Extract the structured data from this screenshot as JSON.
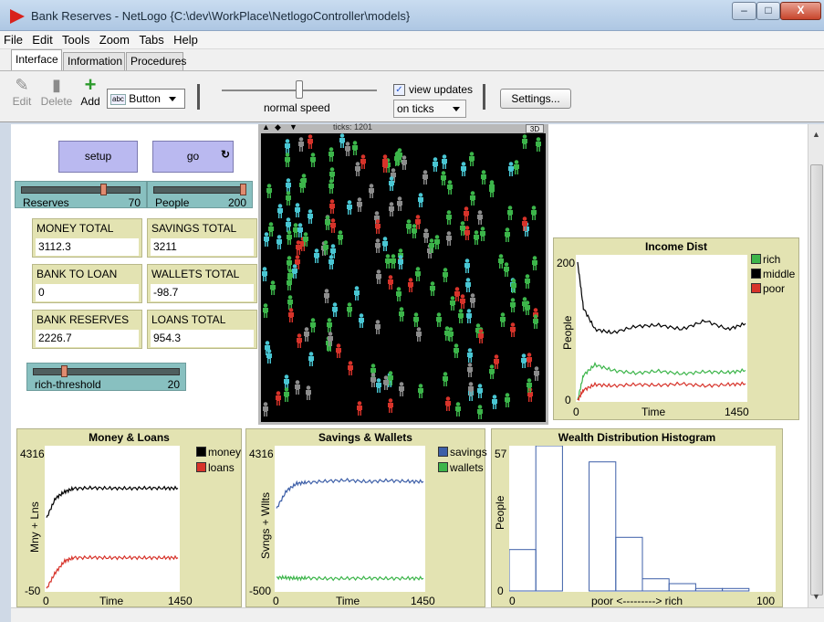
{
  "window": {
    "title": "Bank Reserves - NetLogo {C:\\dev\\WorkPlace\\NetlogoController\\models}",
    "minimize": "–",
    "maximize": "□",
    "close": "X"
  },
  "menu": [
    "File",
    "Edit",
    "Tools",
    "Zoom",
    "Tabs",
    "Help"
  ],
  "tabs": [
    "Interface",
    "Information",
    "Procedures"
  ],
  "toolbar": {
    "edit": "Edit",
    "delete": "Delete",
    "add": "Add",
    "widget_type": "Button",
    "widget_icon_text": "abc",
    "speed_label": "normal speed",
    "view_updates": "view updates",
    "view_updates_checked": true,
    "update_mode": "on ticks",
    "settings": "Settings..."
  },
  "buttons": {
    "setup": "setup",
    "go": "go",
    "forever_icon": "↻"
  },
  "sliders": {
    "reserves": {
      "label": "Reserves",
      "value": "70",
      "fraction": 0.7
    },
    "people": {
      "label": "People",
      "value": "200",
      "fraction": 1.0
    },
    "rich_threshold": {
      "label": "rich-threshold",
      "value": "20",
      "fraction": 0.2
    }
  },
  "monitors": {
    "money_total": {
      "label": "MONEY TOTAL",
      "value": "3112.3"
    },
    "savings_total": {
      "label": "SAVINGS TOTAL",
      "value": "3211"
    },
    "bank_to_loan": {
      "label": "BANK TO LOAN",
      "value": "0"
    },
    "wallets_total": {
      "label": "WALLETS TOTAL",
      "value": "-98.7"
    },
    "bank_reserves": {
      "label": "BANK RESERVES",
      "value": "2226.7"
    },
    "loans_total": {
      "label": "LOANS TOTAL",
      "value": "954.3"
    }
  },
  "view": {
    "ticks_label": "ticks: 1201",
    "btn_3d": "3D"
  },
  "colors": {
    "rich": "#3cb54a",
    "middle": "#000000",
    "poor": "#d7332a",
    "money": "#000000",
    "loans": "#d7332a",
    "savings": "#3d5fa8",
    "wallets": "#3cb54a",
    "histogram": "#3d5fa8",
    "turtle_cyan": "#49c6d3",
    "turtle_gray": "#8c8c8c"
  },
  "chart_data": [
    {
      "type": "line",
      "title": "Income Dist",
      "xlabel": "Time",
      "ylabel": "People",
      "xlim": [
        0,
        1450
      ],
      "ylim": [
        0,
        200
      ],
      "x_tick_labels": [
        "0",
        "1450"
      ],
      "y_tick_labels": [
        "200",
        "0"
      ],
      "series": [
        {
          "name": "rich",
          "x": [
            0,
            50,
            150,
            300,
            500,
            700,
            900,
            1100,
            1300,
            1450
          ],
          "values": [
            0,
            35,
            50,
            42,
            38,
            41,
            37,
            40,
            39,
            42
          ]
        },
        {
          "name": "middle",
          "x": [
            0,
            50,
            150,
            300,
            500,
            700,
            900,
            1100,
            1300,
            1450
          ],
          "values": [
            195,
            130,
            100,
            95,
            104,
            106,
            100,
            112,
            100,
            108
          ]
        },
        {
          "name": "poor",
          "x": [
            0,
            50,
            150,
            300,
            500,
            700,
            900,
            1100,
            1300,
            1450
          ],
          "values": [
            0,
            14,
            22,
            20,
            22,
            21,
            23,
            20,
            22,
            23
          ]
        }
      ]
    },
    {
      "type": "line",
      "title": "Money & Loans",
      "xlabel": "Time",
      "ylabel": "Mny + Lns",
      "xlim": [
        0,
        1450
      ],
      "ylim": [
        -50,
        4316
      ],
      "x_tick_labels": [
        "0",
        "Time",
        "1450"
      ],
      "y_tick_labels": [
        "4316",
        "-50"
      ],
      "series": [
        {
          "name": "money",
          "x": [
            0,
            100,
            200,
            300,
            500,
            700,
            900,
            1100,
            1300,
            1450
          ],
          "values": [
            2200,
            2800,
            3000,
            3100,
            3120,
            3110,
            3105,
            3115,
            3110,
            3112
          ]
        },
        {
          "name": "loans",
          "x": [
            0,
            100,
            200,
            300,
            500,
            700,
            900,
            1100,
            1300,
            1450
          ],
          "values": [
            0,
            500,
            850,
            950,
            960,
            950,
            955,
            950,
            952,
            954
          ]
        }
      ]
    },
    {
      "type": "line",
      "title": "Savings & Wallets",
      "xlabel": "Time",
      "ylabel": "Svngs + Wllts",
      "xlim": [
        0,
        1450
      ],
      "ylim": [
        -500,
        4316
      ],
      "x_tick_labels": [
        "0",
        "Time",
        "1450"
      ],
      "y_tick_labels": [
        "4316",
        "-500"
      ],
      "series": [
        {
          "name": "savings",
          "x": [
            0,
            100,
            200,
            300,
            500,
            700,
            900,
            1100,
            1300,
            1450
          ],
          "values": [
            2300,
            2900,
            3150,
            3180,
            3230,
            3260,
            3210,
            3250,
            3220,
            3211
          ]
        },
        {
          "name": "wallets",
          "x": [
            0,
            100,
            200,
            300,
            500,
            700,
            900,
            1100,
            1300,
            1450
          ],
          "values": [
            -60,
            -80,
            -100,
            -90,
            -110,
            -100,
            -95,
            -105,
            -100,
            -99
          ]
        }
      ]
    },
    {
      "type": "bar",
      "title": "Wealth Distribution Histogram",
      "xlabel": "poor <---------> rich",
      "ylabel": "People",
      "xlim": [
        0,
        100
      ],
      "ylim": [
        0,
        57
      ],
      "x_tick_labels": [
        "0",
        "100"
      ],
      "y_tick_labels": [
        "57",
        "0"
      ],
      "bin_width": 10,
      "bins": [
        0,
        10,
        20,
        30,
        40,
        50,
        60,
        70,
        80,
        90
      ],
      "values": [
        17,
        65,
        0,
        53,
        22,
        5,
        3,
        1,
        1,
        0
      ]
    }
  ]
}
